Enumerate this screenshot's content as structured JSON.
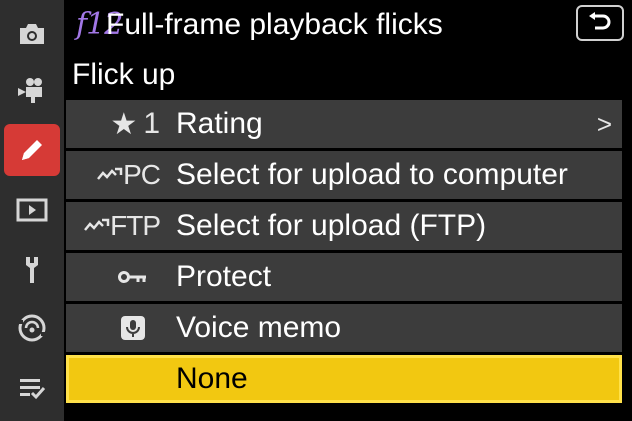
{
  "header": {
    "code": "f12",
    "title": "Full-frame playback flicks"
  },
  "subtitle": "Flick up",
  "sidebar": {
    "items": [
      {
        "icon": "camera-icon",
        "active": false
      },
      {
        "icon": "movie-camera-icon",
        "active": false
      },
      {
        "icon": "pencil-icon",
        "active": true
      },
      {
        "icon": "playback-icon",
        "active": false
      },
      {
        "icon": "wrench-icon",
        "active": false
      },
      {
        "icon": "network-icon",
        "active": false
      },
      {
        "icon": "my-menu-icon",
        "active": false
      }
    ]
  },
  "options": [
    {
      "icon": "star-icon",
      "icon_text": "1",
      "label": "Rating",
      "has_submenu": true
    },
    {
      "icon": "upload-pc-icon",
      "icon_text": "PC",
      "label": "Select for upload to computer",
      "has_submenu": false
    },
    {
      "icon": "upload-ftp-icon",
      "icon_text": "FTP",
      "label": "Select for upload (FTP)",
      "has_submenu": false
    },
    {
      "icon": "key-icon",
      "icon_text": "",
      "label": "Protect",
      "has_submenu": false
    },
    {
      "icon": "microphone-icon",
      "icon_text": "",
      "label": "Voice memo",
      "has_submenu": false
    },
    {
      "icon": "",
      "icon_text": "",
      "label": "None",
      "has_submenu": false,
      "selected": true
    }
  ],
  "submenu_chevron": ">",
  "colors": {
    "accent_active": "#d63a36",
    "selection": "#f2c811",
    "code": "#a277e6",
    "row_bg": "#3c3c3c",
    "sidebar_bg": "#2e2e2e"
  }
}
